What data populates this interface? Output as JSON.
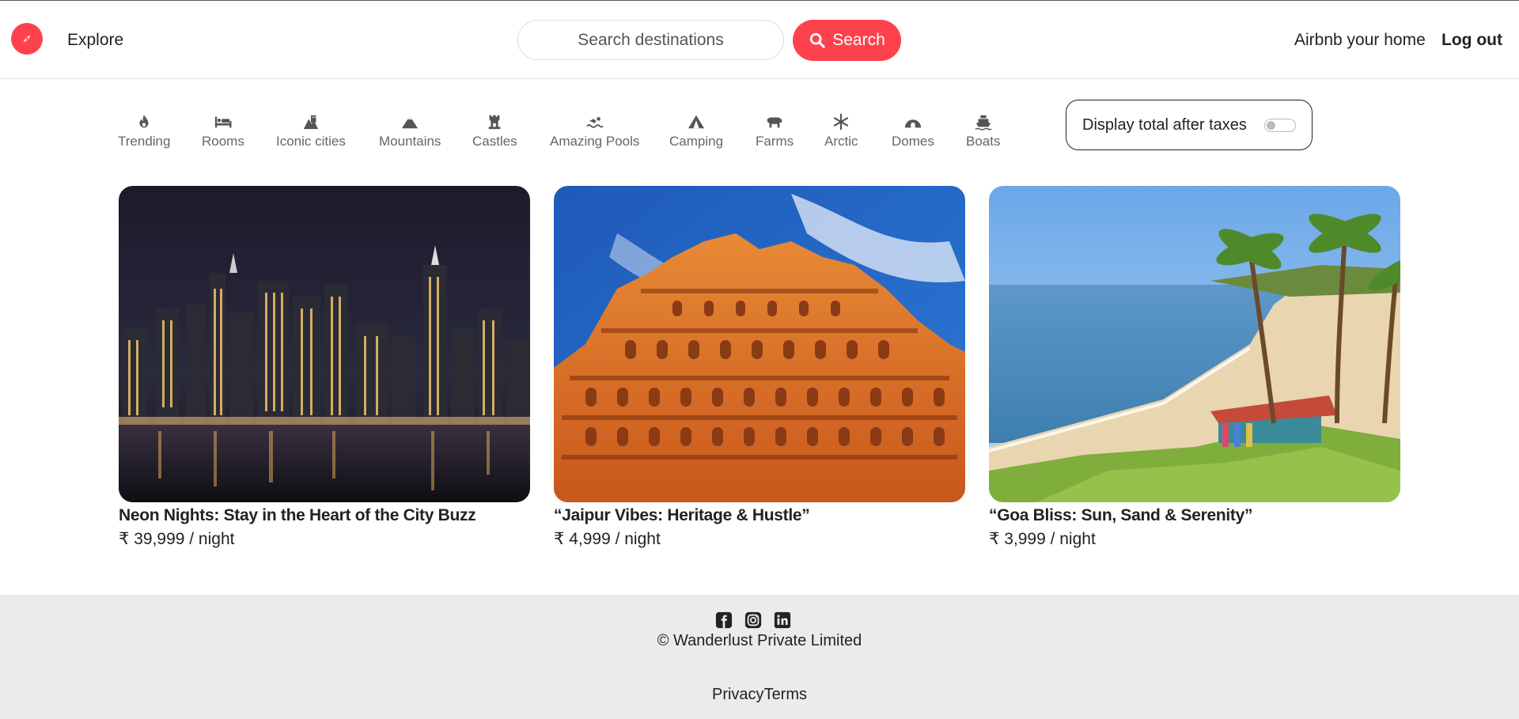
{
  "nav": {
    "explore": "Explore",
    "search_placeholder": "Search destinations",
    "search_button": "Search",
    "host_link": "Airbnb your home",
    "logout": "Log out",
    "brand_color": "#fe424d"
  },
  "filters": [
    {
      "label": "Trending",
      "icon": "fire-icon"
    },
    {
      "label": "Rooms",
      "icon": "bed-icon"
    },
    {
      "label": "Iconic cities",
      "icon": "city-icon"
    },
    {
      "label": "Mountains",
      "icon": "mountain-icon"
    },
    {
      "label": "Castles",
      "icon": "castle-icon"
    },
    {
      "label": "Amazing Pools",
      "icon": "swimmer-icon"
    },
    {
      "label": "Camping",
      "icon": "tent-icon"
    },
    {
      "label": "Farms",
      "icon": "cow-icon"
    },
    {
      "label": "Arctic",
      "icon": "snowflake-icon"
    },
    {
      "label": "Domes",
      "icon": "igloo-icon"
    },
    {
      "label": "Boats",
      "icon": "ship-icon"
    }
  ],
  "tax_toggle": {
    "label": "Display total after taxes",
    "enabled": false
  },
  "listings": [
    {
      "title": "Neon Nights: Stay in the Heart of the City Buzz",
      "price": "₹ 39,999 / night",
      "image": "city-skyline-night"
    },
    {
      "title": "“Jaipur Vibes: Heritage & Hustle”",
      "price": "₹ 4,999 / night",
      "image": "hawa-mahal"
    },
    {
      "title": "“Goa Bliss: Sun, Sand & Serenity”",
      "price": "₹ 3,999 / night",
      "image": "goa-beach"
    }
  ],
  "footer": {
    "socials": [
      "facebook-icon",
      "instagram-icon",
      "linkedin-icon"
    ],
    "copyright": "© Wanderlust Private Limited",
    "privacy": "Privacy",
    "terms": "Terms"
  }
}
